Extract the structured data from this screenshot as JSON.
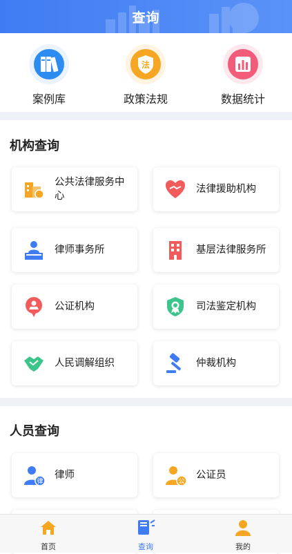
{
  "header": {
    "title": "查询"
  },
  "quick_links": [
    {
      "label": "案例库",
      "icon": "books-icon",
      "color": "#2d8cf0"
    },
    {
      "label": "政策法规",
      "icon": "law-shield-icon",
      "color": "#f5a623"
    },
    {
      "label": "数据统计",
      "icon": "bar-chart-icon",
      "color": "#f25b7a"
    }
  ],
  "institution_section": {
    "title": "机构查询",
    "items": [
      {
        "label": "公共法律服务中心",
        "icon": "building-icon"
      },
      {
        "label": "法律援助机构",
        "icon": "heart-handshake-icon"
      },
      {
        "label": "律师事务所",
        "icon": "lawyer-desk-icon"
      },
      {
        "label": "基层法律服务所",
        "icon": "office-building-icon"
      },
      {
        "label": "公证机构",
        "icon": "notary-icon"
      },
      {
        "label": "司法鉴定机构",
        "icon": "appraisal-badge-icon"
      },
      {
        "label": "人民调解组织",
        "icon": "handshake-icon"
      },
      {
        "label": "仲裁机构",
        "icon": "gavel-icon"
      }
    ]
  },
  "personnel_section": {
    "title": "人员查询",
    "items": [
      {
        "label": "律师",
        "icon": "lawyer-person-icon",
        "badge": "律"
      },
      {
        "label": "公证员",
        "icon": "notary-person-icon",
        "badge": "公"
      }
    ]
  },
  "tabbar": {
    "items": [
      {
        "label": "首页",
        "icon": "home-icon"
      },
      {
        "label": "查询",
        "icon": "search-book-icon",
        "active": true
      },
      {
        "label": "我的",
        "icon": "user-icon"
      }
    ]
  },
  "colors": {
    "primary": "#3f7cf3",
    "orange": "#f5a623",
    "red": "#f25b5b",
    "green": "#3cc48a"
  }
}
